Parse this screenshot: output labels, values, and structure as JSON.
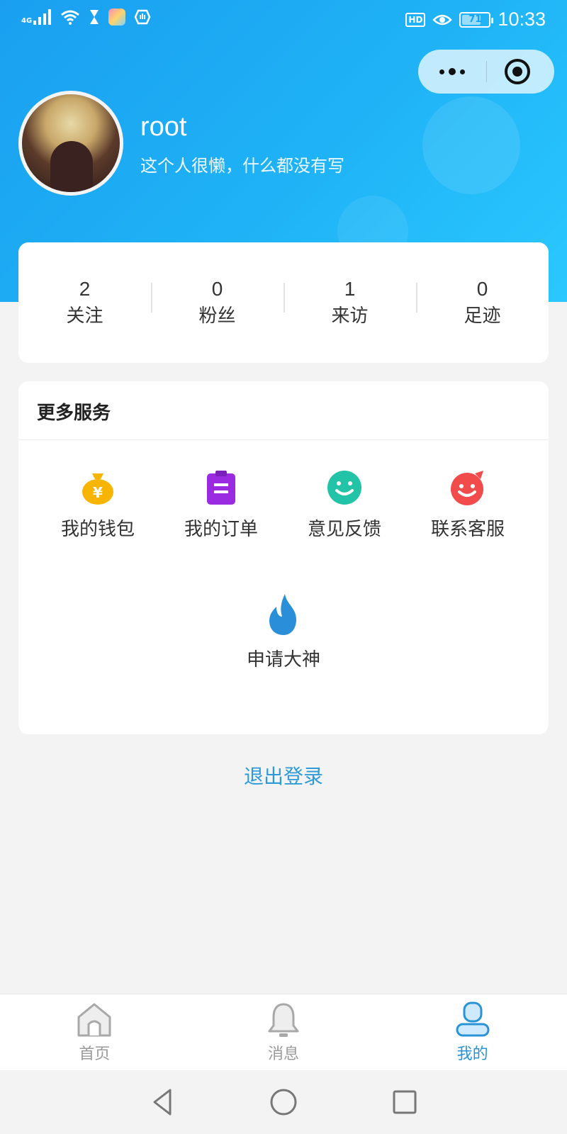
{
  "status_bar": {
    "network": "4G",
    "time": "10:33",
    "battery": "71",
    "hd_label": "HD",
    "battery_level": 0.71
  },
  "profile": {
    "username": "root",
    "bio": "这个人很懒，什么都没有写"
  },
  "stats": [
    {
      "value": "2",
      "label": "关注"
    },
    {
      "value": "0",
      "label": "粉丝"
    },
    {
      "value": "1",
      "label": "来访"
    },
    {
      "value": "0",
      "label": "足迹"
    }
  ],
  "services": {
    "title": "更多服务",
    "items": [
      {
        "label": "我的钱包",
        "icon": "money-bag-icon",
        "color": "#f7b400"
      },
      {
        "label": "我的订单",
        "icon": "clipboard-icon",
        "color": "#9b2be0"
      },
      {
        "label": "意见反馈",
        "icon": "smiley-icon",
        "color": "#22c3a6"
      },
      {
        "label": "联系客服",
        "icon": "smiley-bubble-icon",
        "color": "#f24b4b"
      },
      {
        "label": "申请大神",
        "icon": "flame-icon",
        "color": "#2a8fd8"
      }
    ]
  },
  "logout_label": "退出登录",
  "tabbar": [
    {
      "label": "首页",
      "icon": "home-icon",
      "active": false
    },
    {
      "label": "消息",
      "icon": "bell-icon",
      "active": false
    },
    {
      "label": "我的",
      "icon": "user-icon",
      "active": true
    }
  ],
  "colors": {
    "accent": "#2a93d6",
    "hero_start": "#1a9ff0",
    "hero_end": "#2ac8ff",
    "background": "#f3f3f3"
  }
}
